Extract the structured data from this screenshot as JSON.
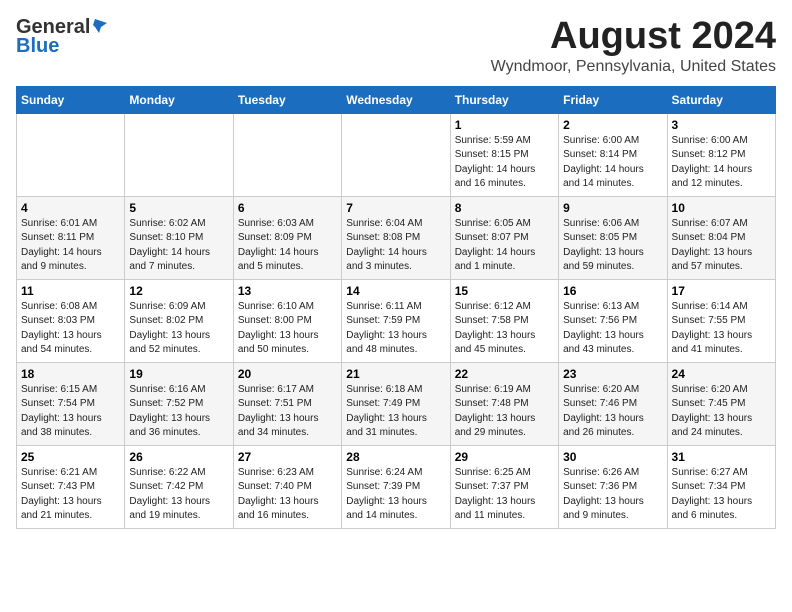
{
  "header": {
    "logo_line1": "General",
    "logo_line2": "Blue",
    "month_title": "August 2024",
    "location": "Wyndmoor, Pennsylvania, United States"
  },
  "days_of_week": [
    "Sunday",
    "Monday",
    "Tuesday",
    "Wednesday",
    "Thursday",
    "Friday",
    "Saturday"
  ],
  "weeks": [
    [
      {
        "day": "",
        "sunrise": "",
        "sunset": "",
        "daylight": ""
      },
      {
        "day": "",
        "sunrise": "",
        "sunset": "",
        "daylight": ""
      },
      {
        "day": "",
        "sunrise": "",
        "sunset": "",
        "daylight": ""
      },
      {
        "day": "",
        "sunrise": "",
        "sunset": "",
        "daylight": ""
      },
      {
        "day": "1",
        "sunrise": "Sunrise: 5:59 AM",
        "sunset": "Sunset: 8:15 PM",
        "daylight": "Daylight: 14 hours and 16 minutes."
      },
      {
        "day": "2",
        "sunrise": "Sunrise: 6:00 AM",
        "sunset": "Sunset: 8:14 PM",
        "daylight": "Daylight: 14 hours and 14 minutes."
      },
      {
        "day": "3",
        "sunrise": "Sunrise: 6:00 AM",
        "sunset": "Sunset: 8:12 PM",
        "daylight": "Daylight: 14 hours and 12 minutes."
      }
    ],
    [
      {
        "day": "4",
        "sunrise": "Sunrise: 6:01 AM",
        "sunset": "Sunset: 8:11 PM",
        "daylight": "Daylight: 14 hours and 9 minutes."
      },
      {
        "day": "5",
        "sunrise": "Sunrise: 6:02 AM",
        "sunset": "Sunset: 8:10 PM",
        "daylight": "Daylight: 14 hours and 7 minutes."
      },
      {
        "day": "6",
        "sunrise": "Sunrise: 6:03 AM",
        "sunset": "Sunset: 8:09 PM",
        "daylight": "Daylight: 14 hours and 5 minutes."
      },
      {
        "day": "7",
        "sunrise": "Sunrise: 6:04 AM",
        "sunset": "Sunset: 8:08 PM",
        "daylight": "Daylight: 14 hours and 3 minutes."
      },
      {
        "day": "8",
        "sunrise": "Sunrise: 6:05 AM",
        "sunset": "Sunset: 8:07 PM",
        "daylight": "Daylight: 14 hours and 1 minute."
      },
      {
        "day": "9",
        "sunrise": "Sunrise: 6:06 AM",
        "sunset": "Sunset: 8:05 PM",
        "daylight": "Daylight: 13 hours and 59 minutes."
      },
      {
        "day": "10",
        "sunrise": "Sunrise: 6:07 AM",
        "sunset": "Sunset: 8:04 PM",
        "daylight": "Daylight: 13 hours and 57 minutes."
      }
    ],
    [
      {
        "day": "11",
        "sunrise": "Sunrise: 6:08 AM",
        "sunset": "Sunset: 8:03 PM",
        "daylight": "Daylight: 13 hours and 54 minutes."
      },
      {
        "day": "12",
        "sunrise": "Sunrise: 6:09 AM",
        "sunset": "Sunset: 8:02 PM",
        "daylight": "Daylight: 13 hours and 52 minutes."
      },
      {
        "day": "13",
        "sunrise": "Sunrise: 6:10 AM",
        "sunset": "Sunset: 8:00 PM",
        "daylight": "Daylight: 13 hours and 50 minutes."
      },
      {
        "day": "14",
        "sunrise": "Sunrise: 6:11 AM",
        "sunset": "Sunset: 7:59 PM",
        "daylight": "Daylight: 13 hours and 48 minutes."
      },
      {
        "day": "15",
        "sunrise": "Sunrise: 6:12 AM",
        "sunset": "Sunset: 7:58 PM",
        "daylight": "Daylight: 13 hours and 45 minutes."
      },
      {
        "day": "16",
        "sunrise": "Sunrise: 6:13 AM",
        "sunset": "Sunset: 7:56 PM",
        "daylight": "Daylight: 13 hours and 43 minutes."
      },
      {
        "day": "17",
        "sunrise": "Sunrise: 6:14 AM",
        "sunset": "Sunset: 7:55 PM",
        "daylight": "Daylight: 13 hours and 41 minutes."
      }
    ],
    [
      {
        "day": "18",
        "sunrise": "Sunrise: 6:15 AM",
        "sunset": "Sunset: 7:54 PM",
        "daylight": "Daylight: 13 hours and 38 minutes."
      },
      {
        "day": "19",
        "sunrise": "Sunrise: 6:16 AM",
        "sunset": "Sunset: 7:52 PM",
        "daylight": "Daylight: 13 hours and 36 minutes."
      },
      {
        "day": "20",
        "sunrise": "Sunrise: 6:17 AM",
        "sunset": "Sunset: 7:51 PM",
        "daylight": "Daylight: 13 hours and 34 minutes."
      },
      {
        "day": "21",
        "sunrise": "Sunrise: 6:18 AM",
        "sunset": "Sunset: 7:49 PM",
        "daylight": "Daylight: 13 hours and 31 minutes."
      },
      {
        "day": "22",
        "sunrise": "Sunrise: 6:19 AM",
        "sunset": "Sunset: 7:48 PM",
        "daylight": "Daylight: 13 hours and 29 minutes."
      },
      {
        "day": "23",
        "sunrise": "Sunrise: 6:20 AM",
        "sunset": "Sunset: 7:46 PM",
        "daylight": "Daylight: 13 hours and 26 minutes."
      },
      {
        "day": "24",
        "sunrise": "Sunrise: 6:20 AM",
        "sunset": "Sunset: 7:45 PM",
        "daylight": "Daylight: 13 hours and 24 minutes."
      }
    ],
    [
      {
        "day": "25",
        "sunrise": "Sunrise: 6:21 AM",
        "sunset": "Sunset: 7:43 PM",
        "daylight": "Daylight: 13 hours and 21 minutes."
      },
      {
        "day": "26",
        "sunrise": "Sunrise: 6:22 AM",
        "sunset": "Sunset: 7:42 PM",
        "daylight": "Daylight: 13 hours and 19 minutes."
      },
      {
        "day": "27",
        "sunrise": "Sunrise: 6:23 AM",
        "sunset": "Sunset: 7:40 PM",
        "daylight": "Daylight: 13 hours and 16 minutes."
      },
      {
        "day": "28",
        "sunrise": "Sunrise: 6:24 AM",
        "sunset": "Sunset: 7:39 PM",
        "daylight": "Daylight: 13 hours and 14 minutes."
      },
      {
        "day": "29",
        "sunrise": "Sunrise: 6:25 AM",
        "sunset": "Sunset: 7:37 PM",
        "daylight": "Daylight: 13 hours and 11 minutes."
      },
      {
        "day": "30",
        "sunrise": "Sunrise: 6:26 AM",
        "sunset": "Sunset: 7:36 PM",
        "daylight": "Daylight: 13 hours and 9 minutes."
      },
      {
        "day": "31",
        "sunrise": "Sunrise: 6:27 AM",
        "sunset": "Sunset: 7:34 PM",
        "daylight": "Daylight: 13 hours and 6 minutes."
      }
    ]
  ]
}
